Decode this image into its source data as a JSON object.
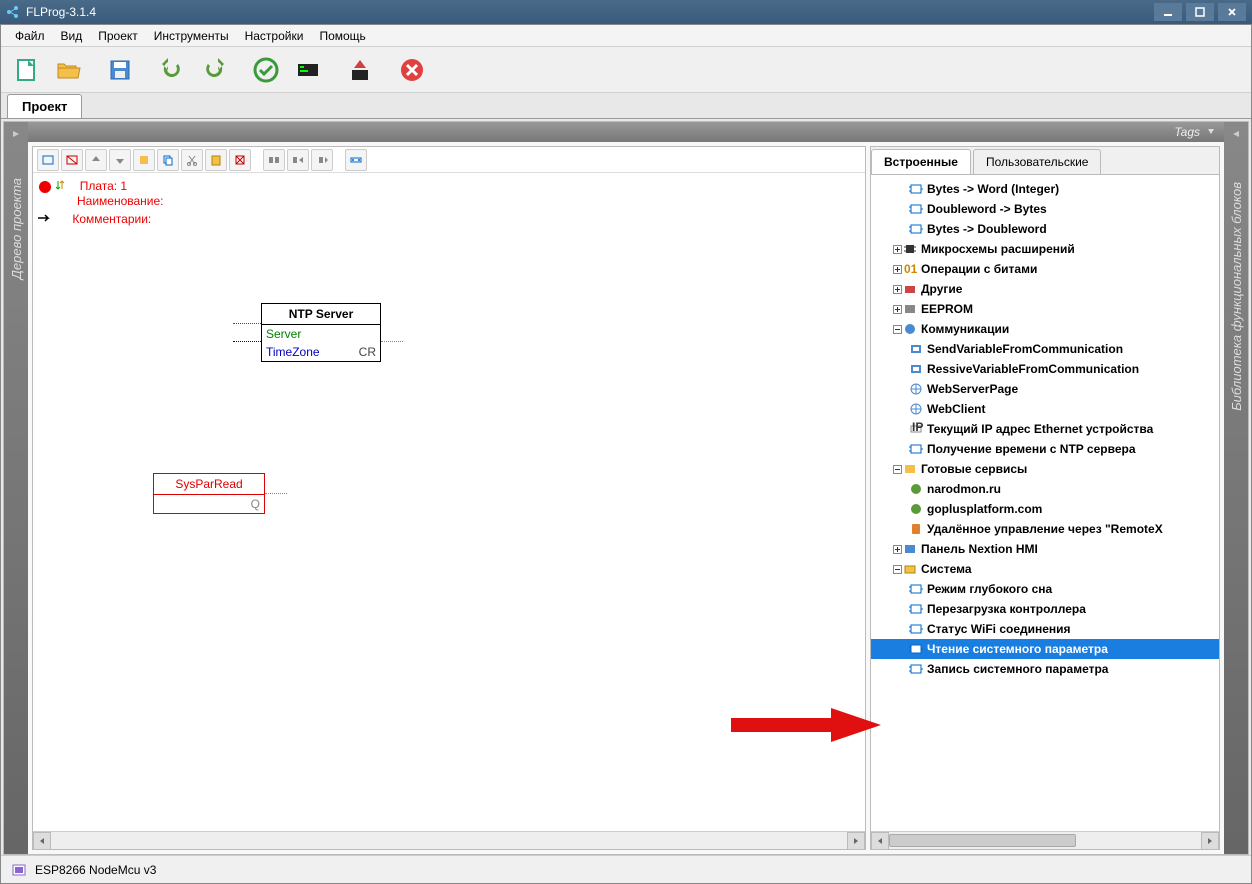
{
  "title": "FLProg-3.1.4",
  "menu": {
    "file": "Файл",
    "view": "Вид",
    "project": "Проект",
    "tools": "Инструменты",
    "settings": "Настройки",
    "help": "Помощь"
  },
  "tab_project": "Проект",
  "left_panel_label": "Дерево проекта",
  "right_panel_label": "Библиотека функциональных блоков",
  "tags_label": "Tags",
  "board": {
    "plata": "Плата: 1",
    "name": "Наименование:",
    "comment": "Комментарии:"
  },
  "ntp": {
    "title": "NTP Server",
    "server": "Server",
    "timezone": "TimeZone",
    "cr": "CR"
  },
  "spr": {
    "title": "SysParRead",
    "q": "Q"
  },
  "lib": {
    "tab_builtin": "Встроенные",
    "tab_user": "Пользовательские",
    "items": [
      {
        "ind": 2,
        "ic": "block",
        "label": "Bytes -> Word (Integer)"
      },
      {
        "ind": 2,
        "ic": "block",
        "label": "Doubleword -> Bytes"
      },
      {
        "ind": 2,
        "ic": "block",
        "label": "Bytes -> Doubleword"
      },
      {
        "ind": 1,
        "exp": "+",
        "ic": "chip",
        "label": "Микросхемы расширений"
      },
      {
        "ind": 1,
        "exp": "+",
        "ic": "bits",
        "label": "Операции с битами"
      },
      {
        "ind": 1,
        "exp": "+",
        "ic": "other",
        "label": "Другие"
      },
      {
        "ind": 1,
        "exp": "+",
        "ic": "eeprom",
        "label": "EEPROM"
      },
      {
        "ind": 1,
        "exp": "-",
        "ic": "comm",
        "label": "Коммуникации"
      },
      {
        "ind": 2,
        "ic": "net",
        "label": "SendVariableFromCommunication"
      },
      {
        "ind": 2,
        "ic": "net",
        "label": "RessiveVariableFromCommunication"
      },
      {
        "ind": 2,
        "ic": "web",
        "label": "WebServerPage"
      },
      {
        "ind": 2,
        "ic": "web",
        "label": "WebClient"
      },
      {
        "ind": 2,
        "ic": "ip",
        "label": "Текущий IP адрес Ethernet устройства"
      },
      {
        "ind": 2,
        "ic": "block",
        "label": "Получение времени с NTP сервера"
      },
      {
        "ind": 1,
        "exp": "-",
        "ic": "svc",
        "label": "Готовые сервисы"
      },
      {
        "ind": 2,
        "ic": "site",
        "label": "narodmon.ru"
      },
      {
        "ind": 2,
        "ic": "site",
        "label": "goplusplatform.com"
      },
      {
        "ind": 2,
        "ic": "remote",
        "label": "Удалённое управление через \"RemoteX"
      },
      {
        "ind": 1,
        "exp": "+",
        "ic": "hmi",
        "label": "Панель Nextion HMI"
      },
      {
        "ind": 1,
        "exp": "-",
        "ic": "sys",
        "label": "Система"
      },
      {
        "ind": 2,
        "ic": "block",
        "label": "Режим глубокого сна"
      },
      {
        "ind": 2,
        "ic": "block",
        "label": "Перезагрузка контроллера"
      },
      {
        "ind": 2,
        "ic": "block",
        "label": "Статус WiFi соединения"
      },
      {
        "ind": 2,
        "ic": "block",
        "label": "Чтение системного параметра",
        "selected": true
      },
      {
        "ind": 2,
        "ic": "block",
        "label": "Запись системного параметра"
      }
    ]
  },
  "status": "ESP8266 NodeMcu v3"
}
